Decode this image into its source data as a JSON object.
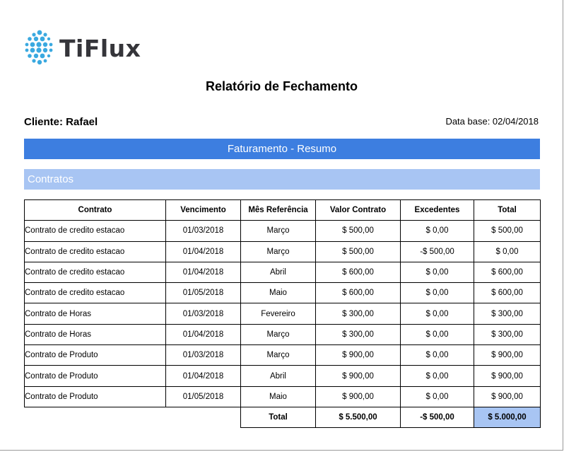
{
  "brand": {
    "name": "TiFlux"
  },
  "report": {
    "title": "Relatório de Fechamento",
    "client": "Cliente: Rafael",
    "date_base": "Data base: 02/04/2018",
    "banner": "Faturamento - Resumo",
    "section": "Contratos"
  },
  "table": {
    "headers": [
      "Contrato",
      "Vencimento",
      "Mês Referência",
      "Valor Contrato",
      "Excedentes",
      "Total"
    ],
    "rows": [
      [
        "Contrato de credito estacao",
        "01/03/2018",
        "Março",
        "$ 500,00",
        "$ 0,00",
        "$ 500,00"
      ],
      [
        "Contrato de credito estacao",
        "01/04/2018",
        "Março",
        "$ 500,00",
        "-$ 500,00",
        "$ 0,00"
      ],
      [
        "Contrato de credito estacao",
        "01/04/2018",
        "Abril",
        "$ 600,00",
        "$ 0,00",
        "$ 600,00"
      ],
      [
        "Contrato de credito estacao",
        "01/05/2018",
        "Maio",
        "$ 600,00",
        "$ 0,00",
        "$ 600,00"
      ],
      [
        "Contrato de Horas",
        "01/03/2018",
        "Fevereiro",
        "$ 300,00",
        "$ 0,00",
        "$ 300,00"
      ],
      [
        "Contrato de Horas",
        "01/04/2018",
        "Março",
        "$ 300,00",
        "$ 0,00",
        "$ 300,00"
      ],
      [
        "Contrato de Produto",
        "01/03/2018",
        "Março",
        "$ 900,00",
        "$ 0,00",
        "$ 900,00"
      ],
      [
        "Contrato de Produto",
        "01/04/2018",
        "Abril",
        "$ 900,00",
        "$ 0,00",
        "$ 900,00"
      ],
      [
        "Contrato de Produto",
        "01/05/2018",
        "Maio",
        "$ 900,00",
        "$ 0,00",
        "$ 900,00"
      ]
    ],
    "total": {
      "label": "Total",
      "valor": "$ 5.500,00",
      "excedentes": "-$ 500,00",
      "total": "$ 5.000,00"
    }
  },
  "colors": {
    "banner": "#3d7ee0",
    "section": "#a8c5f3",
    "logo_dots": "#3aa9e0"
  }
}
